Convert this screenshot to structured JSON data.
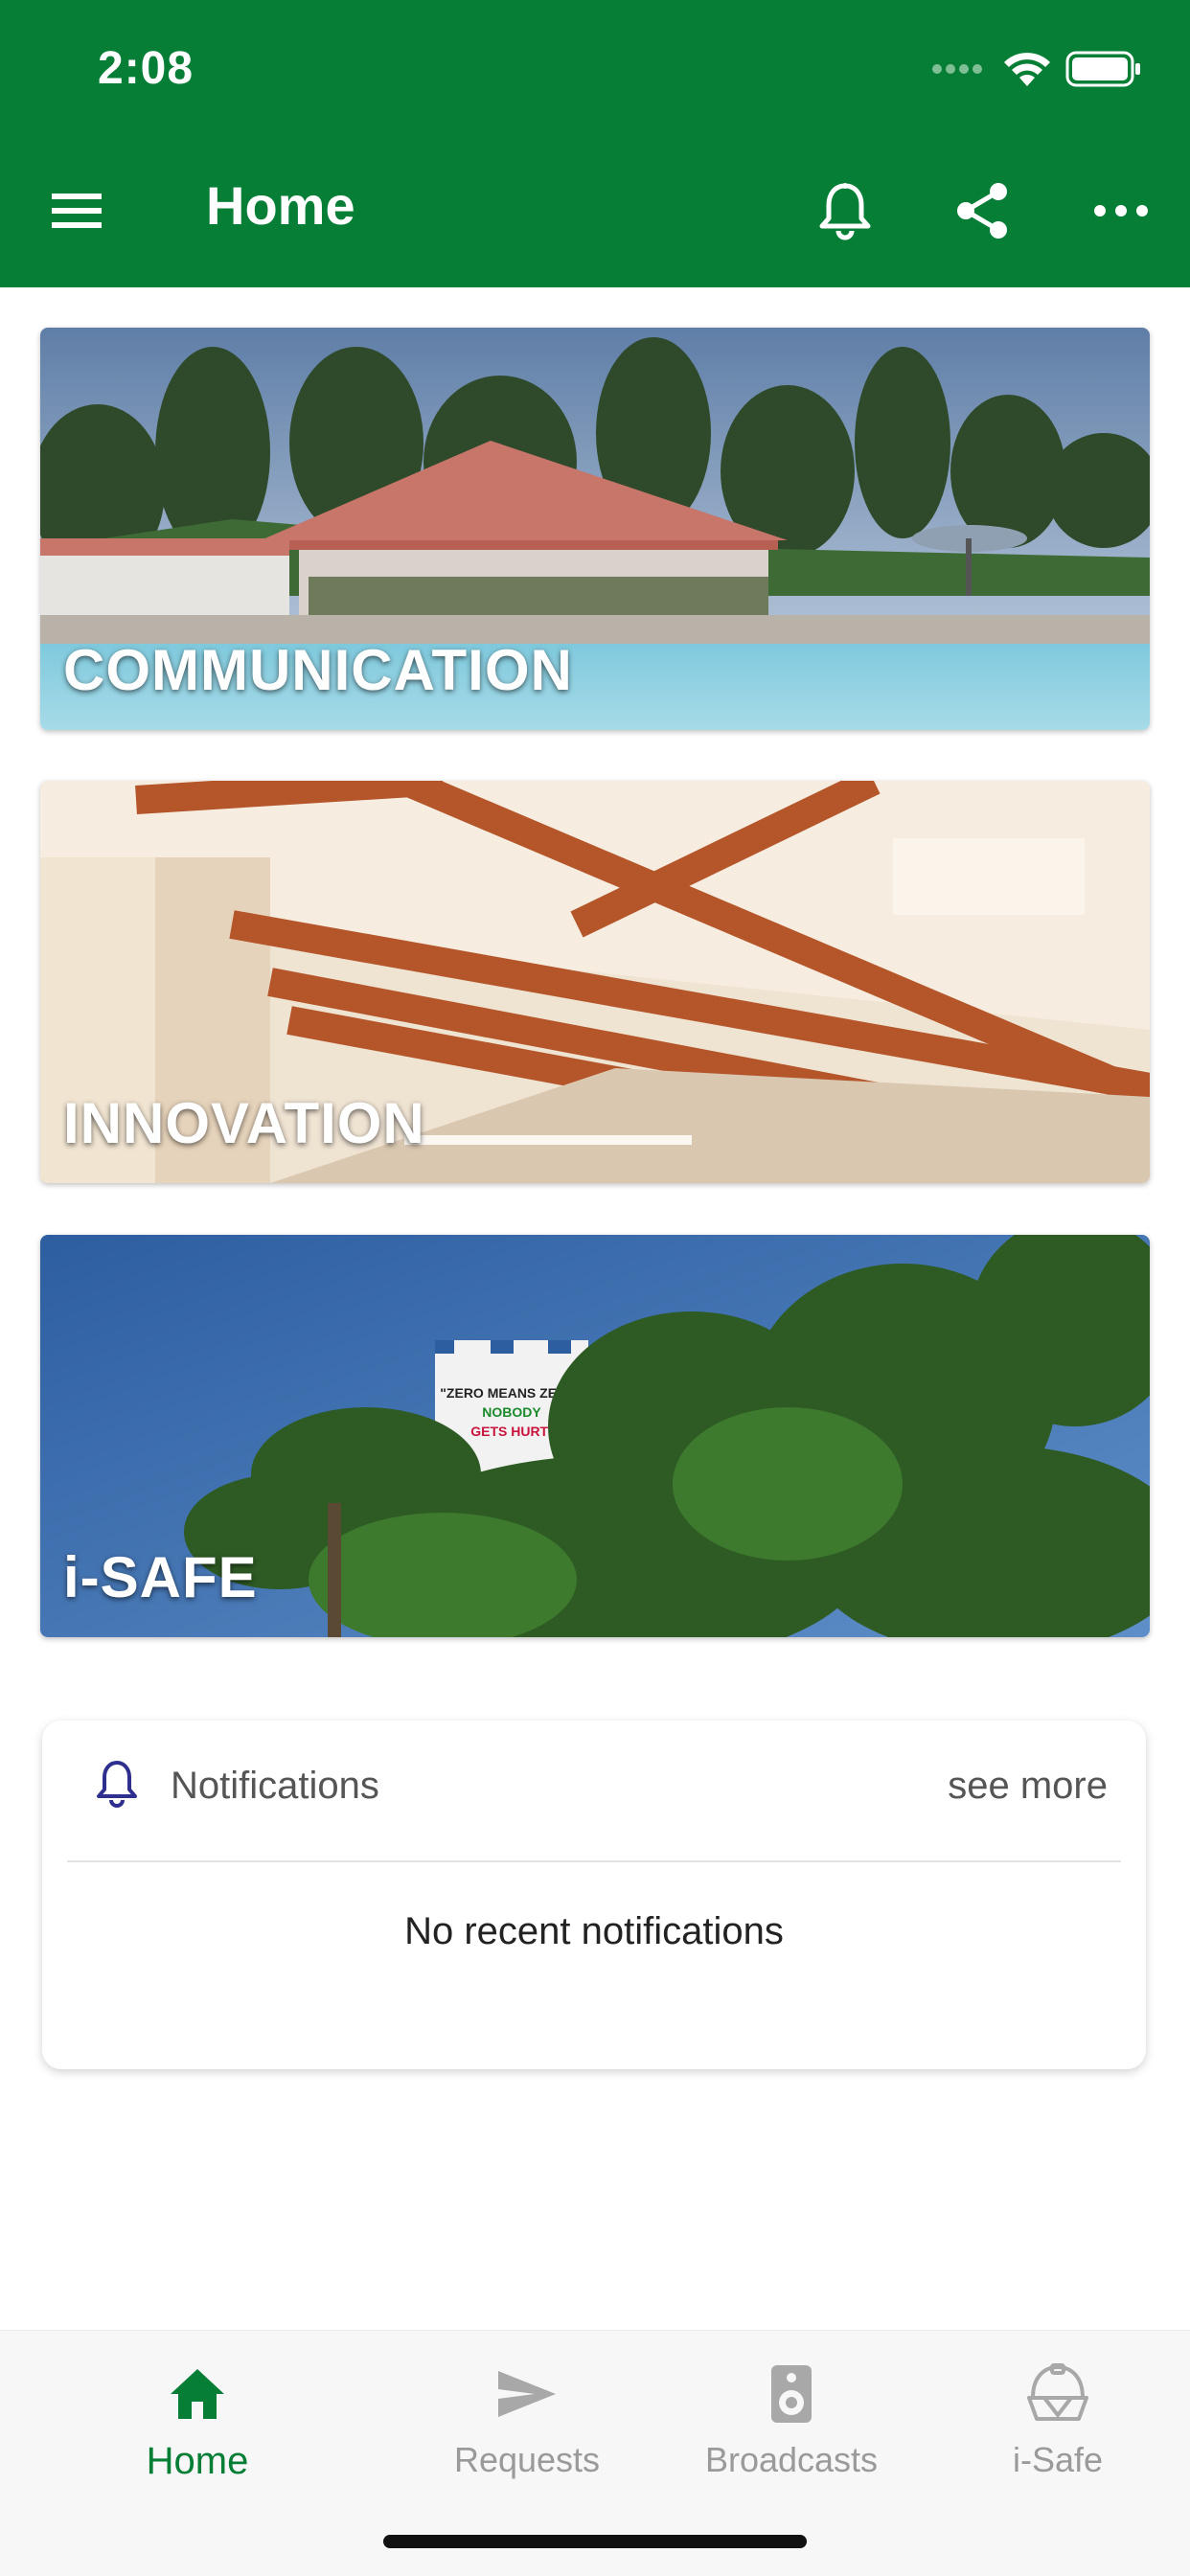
{
  "status_bar": {
    "time": "2:08"
  },
  "app_bar": {
    "title": "Home"
  },
  "cards": [
    {
      "label": "COMMUNICATION"
    },
    {
      "label": "INNOVATION"
    },
    {
      "label": "i-SAFE",
      "sign_lines": [
        "\"ZERO MEANS ZERO\"",
        "NOBODY",
        "GETS HURT!"
      ]
    }
  ],
  "notifications": {
    "title": "Notifications",
    "see_more": "see more",
    "empty_message": "No recent notifications"
  },
  "bottom_nav": {
    "items": [
      {
        "label": "Home",
        "icon": "home-icon",
        "active": true
      },
      {
        "label": "Requests",
        "icon": "send-icon",
        "active": false
      },
      {
        "label": "Broadcasts",
        "icon": "speaker-icon",
        "active": false
      },
      {
        "label": "i-Safe",
        "icon": "helmet-icon",
        "active": false
      }
    ]
  },
  "colors": {
    "primary": "#067e36",
    "bell_accent": "#2f2f8f",
    "inactive": "#9a9a9a"
  }
}
